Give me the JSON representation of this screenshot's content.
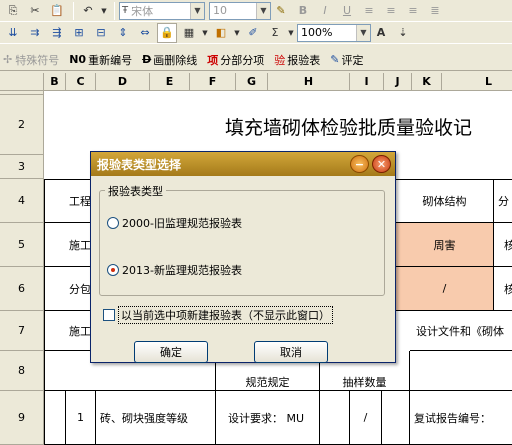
{
  "toolbar1": {
    "font_name": "宋体",
    "font_size": "10",
    "zoom": "100%"
  },
  "toolbar3": {
    "special_symbol": "特殊符号",
    "renumber": "重新编号",
    "strikethrough": "画删除线",
    "subitem": "分部分项",
    "report_form": "报验表",
    "evaluate": "评定"
  },
  "sheet": {
    "columns": [
      "B",
      "C",
      "D",
      "E",
      "F",
      "G",
      "H",
      "I",
      "J",
      "K",
      "L"
    ],
    "rows": [
      "2",
      "3",
      "4",
      "5",
      "6",
      "7",
      "8",
      "9"
    ],
    "title": "填充墙砌体检验批质量验收记",
    "cells": {
      "r4_project": "工程",
      "r4_masonry": "砌体结构",
      "r4_part": "分",
      "r5_construct": "施工",
      "r5_name": "周害",
      "r5_right": "核",
      "r6_sub": "分包",
      "r6_slash": "/",
      "r6_right": "核",
      "r7_construct": "施工",
      "r7_design": "设计文件和《砌体",
      "r8_spec": "规范规定",
      "r8_count": "抽样数量",
      "r9_no": "1",
      "r9_item": "砖、砌块强度等级",
      "r9_design": "设计要求： MU",
      "r9_slash": "/",
      "r9_report": "复试报告编号："
    }
  },
  "dialog": {
    "title": "报验表类型选择",
    "group_label": "报验表类型",
    "option1": "2000-旧监理规范报验表",
    "option2": "2013-新监理规范报验表",
    "selected": "option2",
    "checkbox_label": "以当前选中项新建报验表（不显示此窗口）",
    "ok": "确定",
    "cancel": "取消"
  },
  "colors": {
    "peach": "#f8cbad",
    "dialog_title": "#b88a28"
  }
}
